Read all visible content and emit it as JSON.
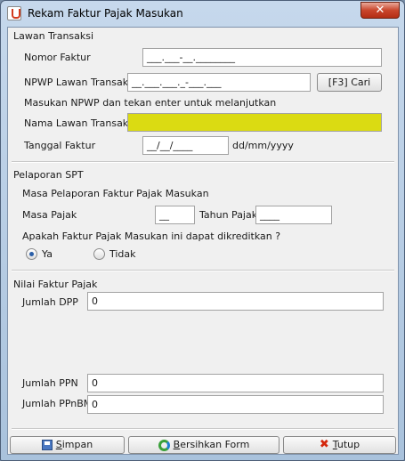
{
  "window": {
    "title": "Rekam Faktur Pajak Masukan",
    "close_symbol": "✕"
  },
  "lawan": {
    "section_title": "Lawan Transaksi",
    "nomor_label": "Nomor Faktur",
    "nomor_value": "___.___-__.________",
    "npwp_label": "NPWP Lawan Transaksi",
    "npwp_value": "__.___.___._-___.___",
    "cari_button": "[F3] Cari",
    "hint": "Masukan NPWP dan tekan enter untuk melanjutkan",
    "nama_label": "Nama Lawan Transaksi",
    "nama_value": "",
    "tanggal_label": "Tanggal Faktur",
    "tanggal_value": "__/__/____",
    "tanggal_format": "dd/mm/yyyy"
  },
  "spt": {
    "section_title": "Pelaporan SPT",
    "subtitle": "Masa Pelaporan Faktur Pajak Masukan",
    "masa_label": "Masa Pajak",
    "masa_value": "__",
    "tahun_label": "Tahun Pajak",
    "tahun_value": "____",
    "question": "Apakah Faktur Pajak Masukan ini dapat dikreditkan ?",
    "option_ya": "Ya",
    "option_tidak": "Tidak",
    "selected": "Ya"
  },
  "nilai": {
    "section_title": "Nilai Faktur Pajak",
    "dpp_label": "Jumlah DPP",
    "dpp_value": "0",
    "ppn_label": "Jumlah PPN",
    "ppn_value": "0",
    "ppnbm_label": "Jumlah PPnBM",
    "ppnbm_value": "0"
  },
  "buttons": {
    "simpan_first": "S",
    "simpan_rest": "impan",
    "bersihkan_first": "B",
    "bersihkan_rest": "ersihkan Form",
    "tutup_first": "T",
    "tutup_rest": "utup"
  }
}
